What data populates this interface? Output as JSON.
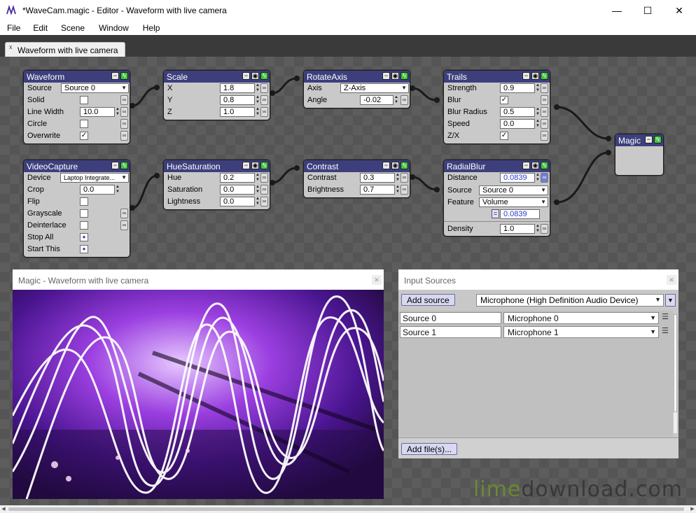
{
  "window": {
    "title": "*WaveCam.magic - Editor - Waveform with live camera",
    "minimize": "—",
    "maximize": "☐",
    "close": "✕"
  },
  "menu": [
    "File",
    "Edit",
    "Scene",
    "Window",
    "Help"
  ],
  "tab": {
    "label": "Waveform with live camera",
    "close": "x"
  },
  "nodes": {
    "waveform": {
      "title": "Waveform",
      "rows": {
        "source": {
          "label": "Source",
          "value": "Source 0"
        },
        "solid": {
          "label": "Solid"
        },
        "line_width": {
          "label": "Line Width",
          "value": "10.0"
        },
        "circle": {
          "label": "Circle"
        },
        "overwrite": {
          "label": "Overwrite"
        }
      }
    },
    "scale": {
      "title": "Scale",
      "rows": {
        "x": {
          "label": "X",
          "value": "1.8"
        },
        "y": {
          "label": "Y",
          "value": "0.8"
        },
        "z": {
          "label": "Z",
          "value": "1.0"
        }
      }
    },
    "rotateaxis": {
      "title": "RotateAxis",
      "rows": {
        "axis": {
          "label": "Axis",
          "value": "Z-Axis"
        },
        "angle": {
          "label": "Angle",
          "value": "-0.02"
        }
      }
    },
    "trails": {
      "title": "Trails",
      "rows": {
        "strength": {
          "label": "Strength",
          "value": "0.9"
        },
        "blur": {
          "label": "Blur"
        },
        "blur_radius": {
          "label": "Blur Radius",
          "value": "0.5"
        },
        "speed": {
          "label": "Speed",
          "value": "0.0"
        },
        "zx": {
          "label": "Z/X"
        }
      }
    },
    "magic": {
      "title": "Magic"
    },
    "videocapture": {
      "title": "VideoCapture",
      "rows": {
        "device": {
          "label": "Device",
          "value": "Laptop Integrate..."
        },
        "crop": {
          "label": "Crop",
          "value": "0.0"
        },
        "flip": {
          "label": "Flip"
        },
        "grayscale": {
          "label": "Grayscale"
        },
        "deinterlace": {
          "label": "Deinterlace"
        },
        "stop_all": {
          "label": "Stop All"
        },
        "start_this": {
          "label": "Start This"
        }
      }
    },
    "huesaturation": {
      "title": "HueSaturation",
      "rows": {
        "hue": {
          "label": "Hue",
          "value": "0.2"
        },
        "saturation": {
          "label": "Saturation",
          "value": "0.0"
        },
        "lightness": {
          "label": "Lightness",
          "value": "0.0"
        }
      }
    },
    "contrast": {
      "title": "Contrast",
      "rows": {
        "contrast": {
          "label": "Contrast",
          "value": "0.3"
        },
        "brightness": {
          "label": "Brightness",
          "value": "0.7"
        }
      }
    },
    "radialblur": {
      "title": "RadialBlur",
      "rows": {
        "distance": {
          "label": "Distance",
          "value": "0.0839"
        },
        "source": {
          "label": "Source",
          "value": "Source 0"
        },
        "feature": {
          "label": "Feature",
          "value": "Volume"
        },
        "feature_value": {
          "value": "0.0839"
        },
        "density": {
          "label": "Density",
          "value": "1.0"
        }
      }
    }
  },
  "preview": {
    "title": "Magic - Waveform with live camera"
  },
  "input_sources": {
    "title": "Input Sources",
    "add_source": "Add source",
    "device": "Microphone (High Definition Audio Device)",
    "sources": [
      {
        "name": "Source 0",
        "input": "Microphone 0"
      },
      {
        "name": "Source 1",
        "input": "Microphone 1"
      }
    ],
    "add_files": "Add file(s)..."
  },
  "watermark": {
    "part1": "lime",
    "part2": "download.com"
  },
  "colors": {
    "node_header": "#3d3f7d",
    "node_body": "#c9c9c9",
    "power_green": "#41c841",
    "canvas": "#555555",
    "accent_blue": "#2a3ad0"
  }
}
